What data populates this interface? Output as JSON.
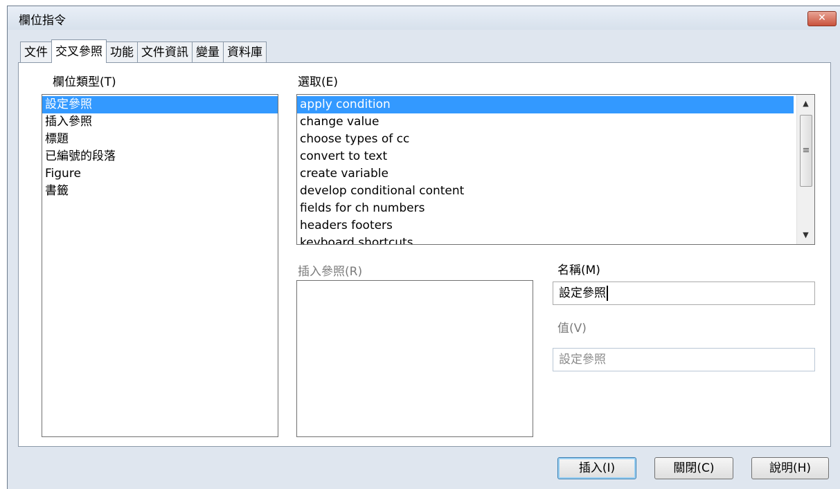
{
  "window": {
    "title": "欄位指令",
    "close_icon": "✕"
  },
  "tabs": [
    {
      "label": "文件"
    },
    {
      "label": "交叉參照",
      "active": true
    },
    {
      "label": "功能"
    },
    {
      "label": "文件資訊"
    },
    {
      "label": "變量"
    },
    {
      "label": "資料庫"
    }
  ],
  "field_type": {
    "label": "欄位類型(T)",
    "items": [
      "設定參照",
      "插入參照",
      "標題",
      "已編號的段落",
      "Figure",
      "書籤"
    ],
    "selected_index": 0
  },
  "selection": {
    "label": "選取(E)",
    "items": [
      "apply condition",
      "change value",
      "choose types of cc",
      "convert to text",
      "create variable",
      "develop conditional content",
      "fields for ch numbers",
      "headers footers",
      "keyboard shortcuts"
    ],
    "selected_index": 0
  },
  "insert_reference": {
    "label": "插入參照(R)"
  },
  "name": {
    "label": "名稱(M)",
    "value": "設定參照"
  },
  "value": {
    "label": "值(V)",
    "value": "設定參照"
  },
  "buttons": {
    "insert": "插入(I)",
    "close": "關閉(C)",
    "help": "說明(H)"
  }
}
